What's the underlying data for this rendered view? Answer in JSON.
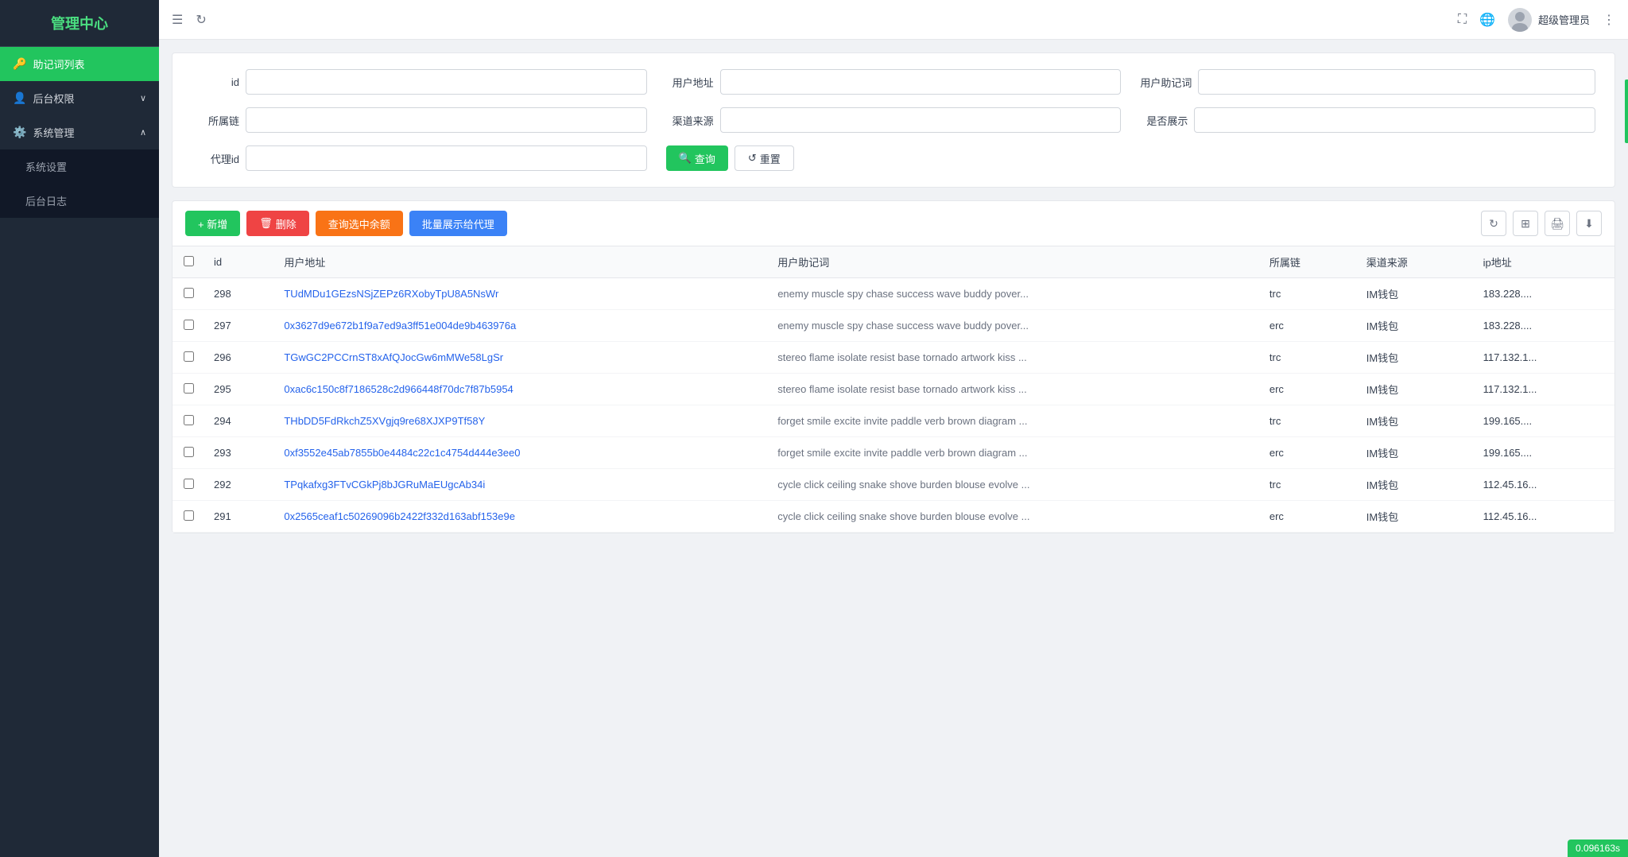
{
  "sidebar": {
    "logo": "管理中心",
    "items": [
      {
        "id": "mnemonic-list",
        "label": "助记词列表",
        "icon": "🔑",
        "active": true,
        "hasSubmenu": false
      },
      {
        "id": "backend-permissions",
        "label": "后台权限",
        "icon": "👤",
        "active": false,
        "hasSubmenu": true,
        "expanded": false
      },
      {
        "id": "system-management",
        "label": "系统管理",
        "icon": "⚙️",
        "active": false,
        "hasSubmenu": true,
        "expanded": true
      }
    ],
    "subItems": [
      {
        "id": "system-settings",
        "label": "系统设置",
        "parent": "system-management"
      },
      {
        "id": "backend-log",
        "label": "后台日志",
        "parent": "system-management"
      }
    ]
  },
  "header": {
    "menu_icon": "☰",
    "refresh_icon": "↻",
    "fullscreen_icon": "⛶",
    "globe_icon": "🌐",
    "more_icon": "⋮",
    "user_name": "超级管理员"
  },
  "filter": {
    "fields": [
      {
        "id": "id",
        "label": "id",
        "placeholder": ""
      },
      {
        "id": "user_address",
        "label": "用户地址",
        "placeholder": ""
      },
      {
        "id": "user_mnemonic",
        "label": "用户助记词",
        "placeholder": ""
      },
      {
        "id": "chain",
        "label": "所属链",
        "placeholder": ""
      },
      {
        "id": "channel",
        "label": "渠道来源",
        "placeholder": ""
      },
      {
        "id": "display",
        "label": "是否展示",
        "placeholder": ""
      },
      {
        "id": "agent_id",
        "label": "代理id",
        "placeholder": ""
      }
    ],
    "search_btn": "查询",
    "reset_btn": "重置"
  },
  "toolbar": {
    "add_btn": "+ 新增",
    "delete_btn": "删除",
    "query_balance_btn": "查询选中余额",
    "batch_display_btn": "批量展示给代理"
  },
  "table": {
    "columns": [
      "id",
      "用户地址",
      "用户助记词",
      "所属链",
      "渠道来源",
      "ip地址"
    ],
    "rows": [
      {
        "id": "298",
        "address": "TUdMDu1GEzsNSjZEPz6RXobyTpU8A5NsWr",
        "address_type": "trc_link",
        "mnemonic": "enemy muscle spy chase success wave buddy pover...",
        "chain": "trc",
        "channel": "IM钱包",
        "ip": "183.228...."
      },
      {
        "id": "297",
        "address": "0x3627d9e672b1f9a7ed9a3ff51e004de9b463976a",
        "address_type": "erc_link",
        "mnemonic": "enemy muscle spy chase success wave buddy pover...",
        "chain": "erc",
        "channel": "IM钱包",
        "ip": "183.228...."
      },
      {
        "id": "296",
        "address": "TGwGC2PCCrnST8xAfQJocGw6mMWe58LgSr",
        "address_type": "trc_link",
        "mnemonic": "stereo flame isolate resist base tornado artwork kiss ...",
        "chain": "trc",
        "channel": "IM钱包",
        "ip": "117.132.1..."
      },
      {
        "id": "295",
        "address": "0xac6c150c8f7186528c2d966448f70dc7f87b5954",
        "address_type": "erc_link",
        "mnemonic": "stereo flame isolate resist base tornado artwork kiss ...",
        "chain": "erc",
        "channel": "IM钱包",
        "ip": "117.132.1..."
      },
      {
        "id": "294",
        "address": "THbDD5FdRkchZ5XVgjq9re68XJXP9Tf58Y",
        "address_type": "trc_link",
        "mnemonic": "forget smile excite invite paddle verb brown diagram ...",
        "chain": "trc",
        "channel": "IM钱包",
        "ip": "199.165...."
      },
      {
        "id": "293",
        "address": "0xf3552e45ab7855b0e4484c22c1c4754d444e3ee0",
        "address_type": "erc_link",
        "mnemonic": "forget smile excite invite paddle verb brown diagram ...",
        "chain": "erc",
        "channel": "IM钱包",
        "ip": "199.165...."
      },
      {
        "id": "292",
        "address": "TPqkafxg3FTvCGkPj8bJGRuMaEUgcAb34i",
        "address_type": "trc_link",
        "mnemonic": "cycle click ceiling snake shove burden blouse evolve ...",
        "chain": "trc",
        "channel": "IM钱包",
        "ip": "112.45.16..."
      },
      {
        "id": "291",
        "address": "0x2565ceaf1c50269096b2422f332d163abf153e9e",
        "address_type": "erc_link",
        "mnemonic": "cycle click ceiling snake shove burden blouse evolve ...",
        "chain": "erc",
        "channel": "IM钱包",
        "ip": "112.45.16..."
      }
    ]
  },
  "badge": {
    "value": "0.096163s"
  }
}
